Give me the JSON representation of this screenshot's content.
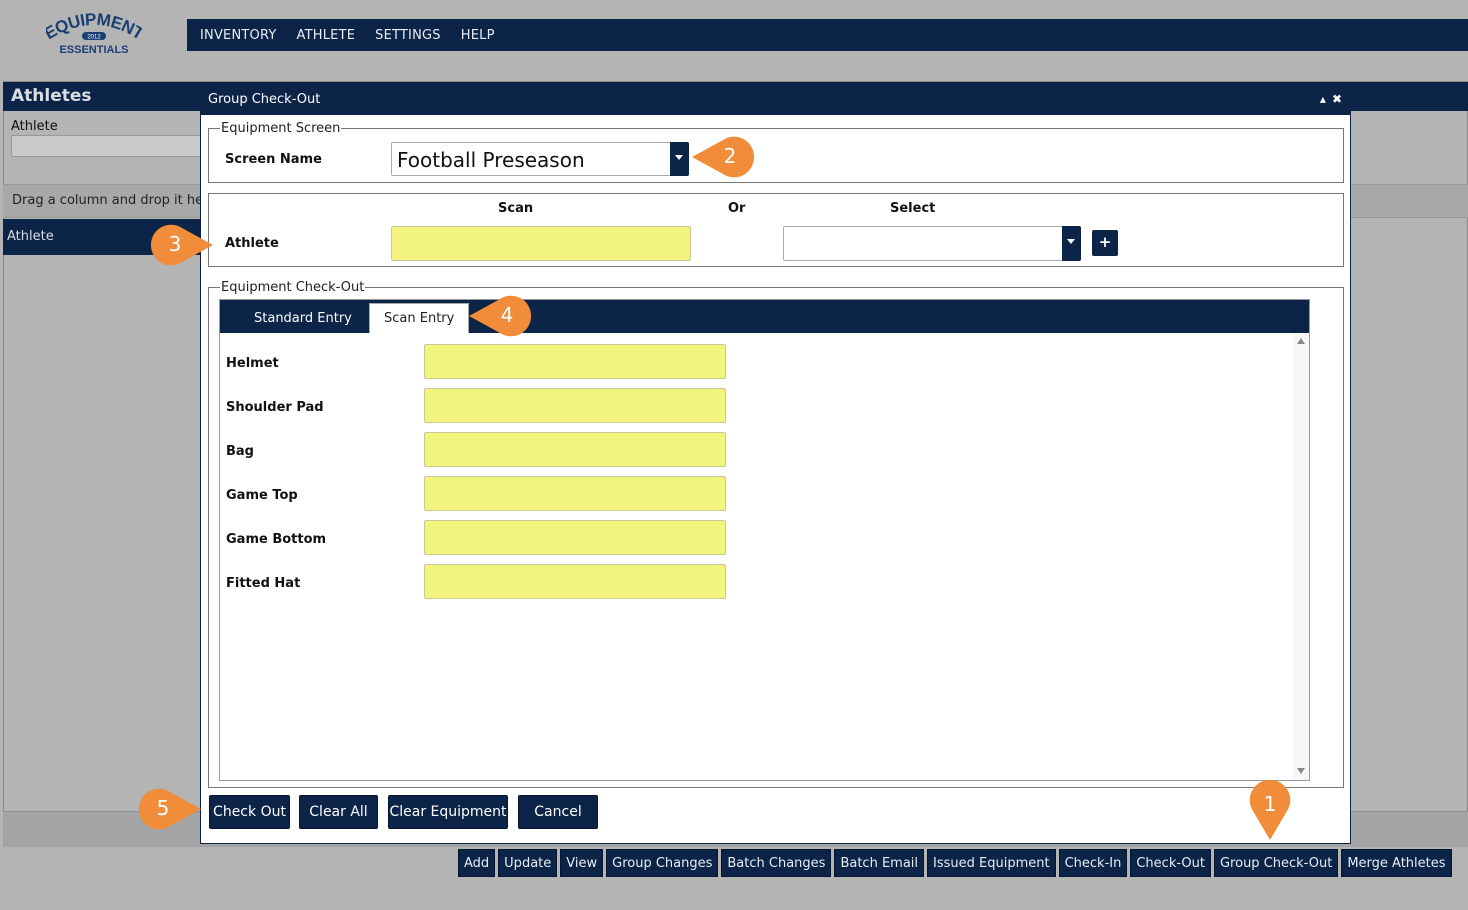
{
  "app": {
    "logo_text_top": "EQUIPMENT",
    "logo_text_year": "2012",
    "logo_text_bottom": "ESSENTIALS",
    "colors": {
      "navy": "#0b2447",
      "scan_yellow": "#f3f380",
      "callout_orange": "#f08c3a"
    }
  },
  "topnav": [
    "INVENTORY",
    "ATHLETE",
    "SETTINGS",
    "HELP"
  ],
  "background": {
    "panel_title": "Athletes",
    "athlete_label": "Athlete",
    "drag_text": "Drag a column and drop it he",
    "grid_header": "Athlete"
  },
  "bottom_buttons": [
    "Add",
    "Update",
    "View",
    "Group Changes",
    "Batch Changes",
    "Batch Email",
    "Issued Equipment",
    "Check-In",
    "Check-Out",
    "Group Check-Out",
    "Merge Athletes"
  ],
  "modal": {
    "title": "Group Check-Out",
    "collapse_icon": "triangle-up-icon",
    "close_icon": "close-icon",
    "equipment_screen": {
      "legend": "Equipment Screen",
      "screen_name_label": "Screen Name",
      "screen_name_value": "Football Preseason"
    },
    "athlete_section": {
      "scan_header": "Scan",
      "or_header": "Or",
      "select_header": "Select",
      "athlete_label": "Athlete",
      "add_icon": "plus-icon",
      "add_symbol": "+"
    },
    "checkout": {
      "legend": "Equipment Check-Out",
      "tabs": [
        "Standard Entry",
        "Scan Entry"
      ],
      "active_tab": "Scan Entry",
      "items": [
        "Helmet",
        "Shoulder Pad",
        "Bag",
        "Game Top",
        "Game Bottom",
        "Fitted Hat"
      ]
    },
    "buttons": {
      "check_out": "Check Out",
      "clear_all": "Clear All",
      "clear_equipment": "Clear Equipment",
      "cancel": "Cancel"
    }
  },
  "callouts": [
    "1",
    "2",
    "3",
    "4",
    "5"
  ]
}
